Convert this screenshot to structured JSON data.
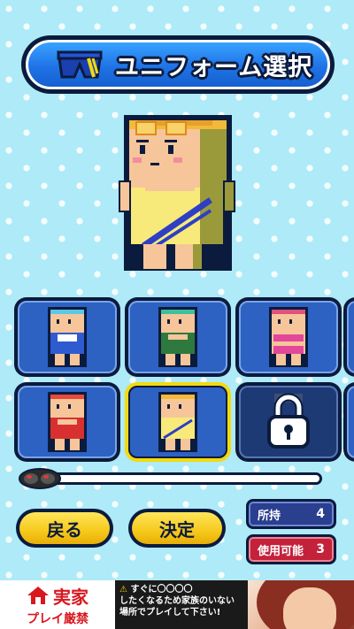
{
  "title": {
    "text": "ユニフォーム選択",
    "icon": "swim-trunks-icon"
  },
  "preview": {
    "character": "selected-character-yellow-swimsuit"
  },
  "costumes": [
    {
      "name": "blue-swimsuit",
      "state": "unlocked",
      "goggles": "#5bc8e8",
      "suit": "#2f5bd0",
      "trim": "#ffffff"
    },
    {
      "name": "green-swimsuit",
      "state": "unlocked",
      "goggles": "#3fbf9a",
      "suit": "#2e7a3e",
      "trim": "#ffffff"
    },
    {
      "name": "pink-bikini",
      "state": "unlocked",
      "goggles": "#e2507e",
      "suit": "#e2479a",
      "trim": "#2a2a2a"
    },
    {
      "name": "red-swimsuit",
      "state": "unlocked",
      "goggles": "#e84a3a",
      "suit": "#d83030",
      "trim": "#ffffff"
    },
    {
      "name": "yellow-swimsuit",
      "state": "selected",
      "goggles": "#f2b93a",
      "suit": "#f7ea7a",
      "trim": "#2d3fc4"
    },
    {
      "name": "locked-costume",
      "state": "locked"
    }
  ],
  "progress": {
    "value": 0.0,
    "knob_icon": "goggles-icon"
  },
  "buttons": {
    "back": "戻る",
    "confirm": "決定"
  },
  "stats": {
    "owned_label": "所持",
    "owned_value": "4",
    "usable_label": "使用可能",
    "usable_value": "3"
  },
  "ad": {
    "brand_name": "実家",
    "brand_sub": "プレイ厳禁",
    "copy_warn": "⚠",
    "copy_line1": "すぐに〇〇〇〇",
    "copy_line2": "したくなるため家族のいない",
    "copy_line3": "場所でプレイして下さい!"
  },
  "colors": {
    "outline": "#0b1b3d",
    "slot_blue": "#2d62c3",
    "selected_border": "#f3da10",
    "owned_bg": "#2b3f8f",
    "usable_bg": "#c4213a",
    "button_yellow": "#f6c91b"
  }
}
